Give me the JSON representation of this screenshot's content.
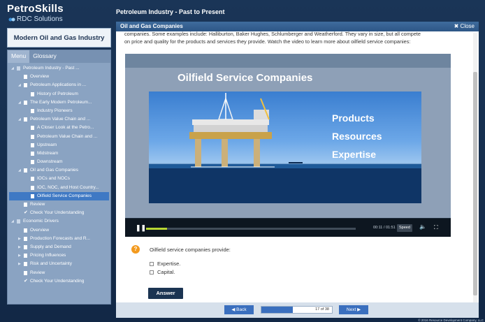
{
  "brand": {
    "name": "PetroSkills",
    "sub": "RDC Solutions"
  },
  "course_title": "Modern Oil and Gas Industry",
  "tabs": [
    {
      "label": "Menu",
      "active": true
    },
    {
      "label": "Glossary",
      "active": false
    }
  ],
  "toc": [
    {
      "label": "Petroleum Industry - Past ...",
      "level": 0,
      "icon": "book",
      "expand": "down"
    },
    {
      "label": "Overview",
      "level": 1,
      "icon": "doc"
    },
    {
      "label": "Petroleum Applications in ...",
      "level": 1,
      "icon": "doc",
      "expand": "down"
    },
    {
      "label": "History of Petroleum",
      "level": 2,
      "icon": "doc"
    },
    {
      "label": "The Early Modern Petroleum...",
      "level": 1,
      "icon": "doc",
      "expand": "down"
    },
    {
      "label": "Industry Pioneers",
      "level": 2,
      "icon": "doc"
    },
    {
      "label": "Petroleum Value Chain and ...",
      "level": 1,
      "icon": "doc",
      "expand": "down"
    },
    {
      "label": "A Closer Look at the Petro...",
      "level": 2,
      "icon": "doc"
    },
    {
      "label": "Petroleum Value Chain and ...",
      "level": 2,
      "icon": "doc"
    },
    {
      "label": "Upstream",
      "level": 2,
      "icon": "doc"
    },
    {
      "label": "Midstream",
      "level": 2,
      "icon": "doc"
    },
    {
      "label": "Downstream",
      "level": 2,
      "icon": "doc"
    },
    {
      "label": "Oil and Gas Companies",
      "level": 1,
      "icon": "doc",
      "expand": "down"
    },
    {
      "label": "IOCs and NOCs",
      "level": 2,
      "icon": "doc"
    },
    {
      "label": "IOC, NOC, and Host Country...",
      "level": 2,
      "icon": "doc"
    },
    {
      "label": "Oilfield Service Companies",
      "level": 2,
      "icon": "doc",
      "selected": true
    },
    {
      "label": "Review",
      "level": 1,
      "icon": "doc"
    },
    {
      "label": "Check Your Understanding",
      "level": 1,
      "icon": "check"
    },
    {
      "label": "Economic Drivers",
      "level": 0,
      "icon": "book",
      "expand": "down"
    },
    {
      "label": "Overview",
      "level": 1,
      "icon": "doc"
    },
    {
      "label": "Production Forecasts and R...",
      "level": 1,
      "icon": "doc",
      "expand": "right"
    },
    {
      "label": "Supply and Demand",
      "level": 1,
      "icon": "doc",
      "expand": "right"
    },
    {
      "label": "Pricing Influences",
      "level": 1,
      "icon": "doc",
      "expand": "right"
    },
    {
      "label": "Risk and Uncertainty",
      "level": 1,
      "icon": "doc",
      "expand": "right"
    },
    {
      "label": "Review",
      "level": 1,
      "icon": "doc"
    },
    {
      "label": "Check Your Understanding",
      "level": 1,
      "icon": "check"
    }
  ],
  "main": {
    "header": "Petroleum Industry - Past to Present",
    "panel_title": "Oil and Gas Companies",
    "close_label": "Close",
    "content_line1": "companies. Some examples include: Halliburton, Baker Hughes, Schlumberger and Weatherford. They vary in size, but all compete",
    "content_line2": "on price and quality for the products and services they provide.  Watch the video to learn more about oilfield service companies:"
  },
  "video": {
    "slide_title": "Oilfield Service Companies",
    "slide_words": [
      "Products",
      "Resources",
      "Expertise"
    ],
    "time": "00:11 / 01:51",
    "speed_label": "Speed",
    "progress": 0.1
  },
  "question": {
    "text": "Oilfield service companies provide:",
    "options": [
      "Expertise.",
      "Capital."
    ],
    "answer_label": "Answer"
  },
  "nav": {
    "back_label": "Back",
    "next_label": "Next",
    "page_text": "17 of 38",
    "current": 17,
    "total": 38
  },
  "copyright": "© 2016 Resource Development Company, LLC",
  "colors": {
    "accent": "#3a6fbe",
    "selected": "#3f79c4",
    "orange": "#f39a1e",
    "progress_green": "#b9d733"
  }
}
